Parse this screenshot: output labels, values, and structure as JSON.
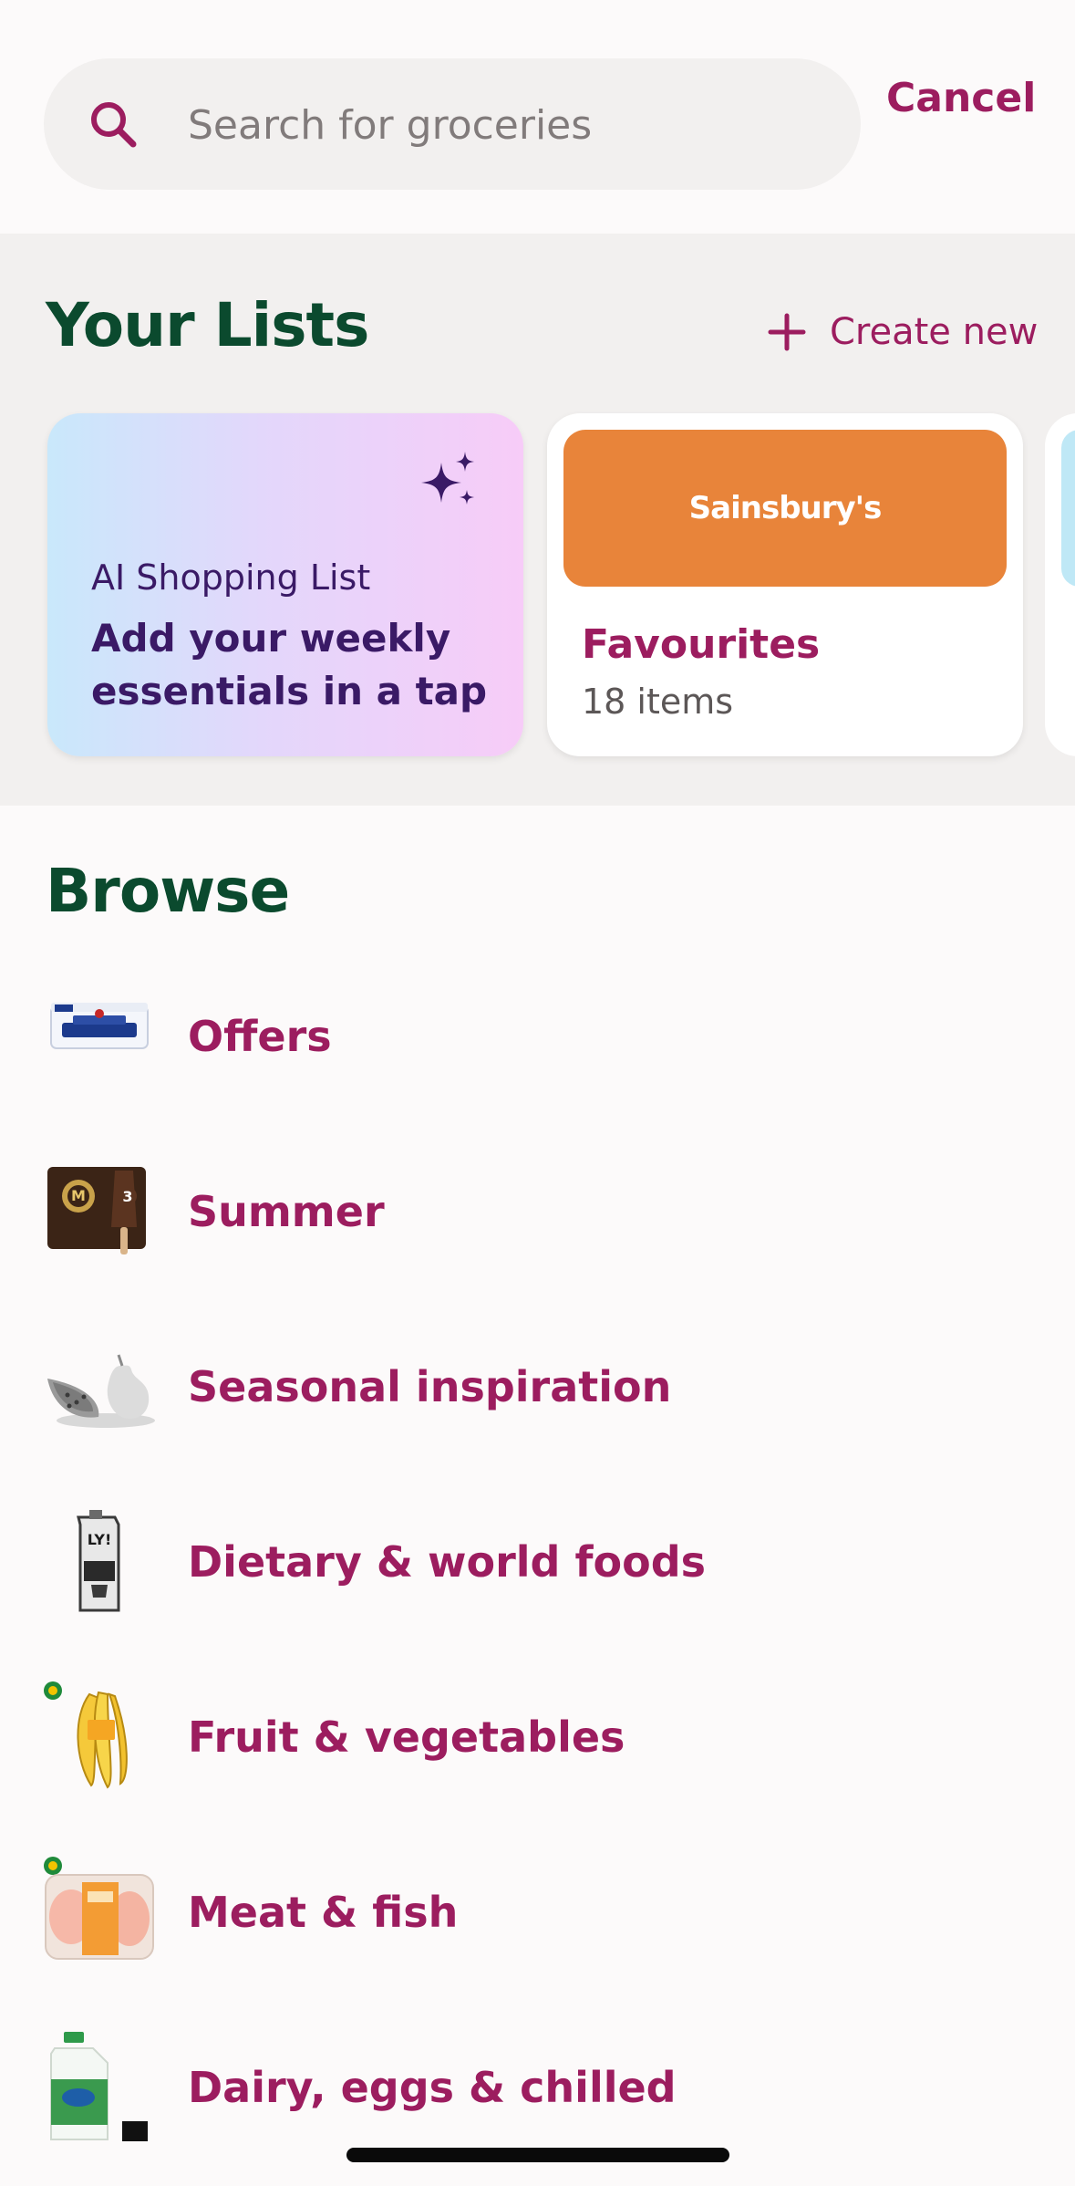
{
  "search": {
    "placeholder": "Search for groceries",
    "cancel_label": "Cancel"
  },
  "lists": {
    "title": "Your Lists",
    "create_label": "Create new",
    "ai_card": {
      "title": "AI Shopping List",
      "subtitle": "Add your weekly essentials in a tap"
    },
    "favourites_card": {
      "brand": "Sainsbury's",
      "title": "Favourites",
      "count": "18 items"
    }
  },
  "browse": {
    "title": "Browse",
    "items": [
      {
        "label": "Offers",
        "icon": "butter-tub-icon"
      },
      {
        "label": "Summer",
        "icon": "ice-cream-icon"
      },
      {
        "label": "Seasonal inspiration",
        "icon": "fruit-icon"
      },
      {
        "label": "Dietary & world foods",
        "icon": "oat-milk-icon"
      },
      {
        "label": "Fruit & vegetables",
        "icon": "bananas-icon"
      },
      {
        "label": "Meat & fish",
        "icon": "chicken-pack-icon"
      },
      {
        "label": "Dairy, eggs & chilled",
        "icon": "milk-bottle-icon"
      }
    ]
  },
  "colors": {
    "accent": "#9c1d5f",
    "heading": "#0b4a2e",
    "ai_text": "#3a1a66",
    "brand_orange": "#e8843a"
  }
}
